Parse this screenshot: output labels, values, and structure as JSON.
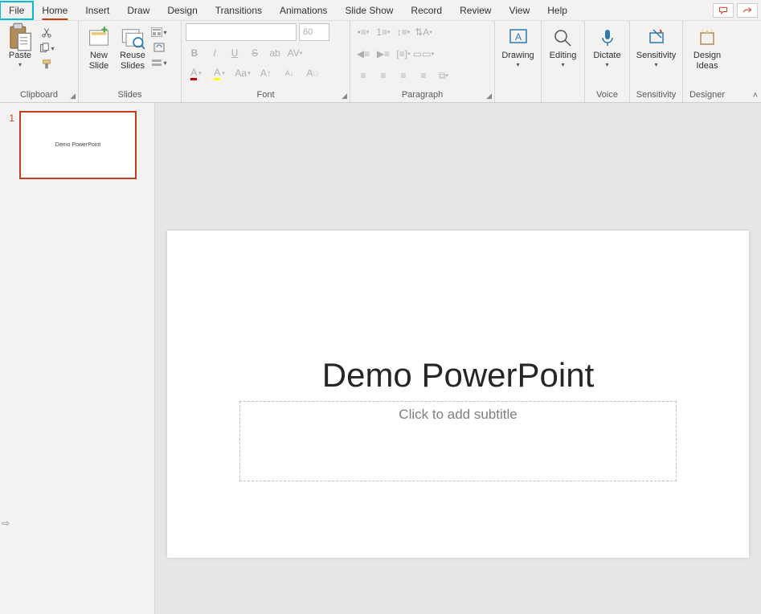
{
  "tabs": {
    "file": "File",
    "home": "Home",
    "insert": "Insert",
    "draw": "Draw",
    "design": "Design",
    "transitions": "Transitions",
    "animations": "Animations",
    "slideshow": "Slide Show",
    "record": "Record",
    "review": "Review",
    "view": "View",
    "help": "Help"
  },
  "ribbon": {
    "clipboard": {
      "label": "Clipboard",
      "paste": "Paste"
    },
    "slides": {
      "label": "Slides",
      "new_slide": "New\nSlide",
      "reuse_slides": "Reuse\nSlides"
    },
    "font": {
      "label": "Font",
      "font_name_placeholder": "",
      "font_size_placeholder": "60"
    },
    "paragraph": {
      "label": "Paragraph"
    },
    "drawing": {
      "label": "Drawing"
    },
    "editing": {
      "label": "Editing"
    },
    "voice": {
      "label": "Voice",
      "dictate": "Dictate"
    },
    "sensitivity": {
      "label": "Sensitivity",
      "btn": "Sensitivity"
    },
    "designer": {
      "label": "Designer",
      "btn": "Design\nIdeas"
    }
  },
  "thumbs": {
    "items": [
      {
        "num": "1",
        "title": "Demo PowerPoint"
      }
    ]
  },
  "slide": {
    "title": "Demo PowerPoint",
    "subtitle_placeholder": "Click to add subtitle"
  }
}
